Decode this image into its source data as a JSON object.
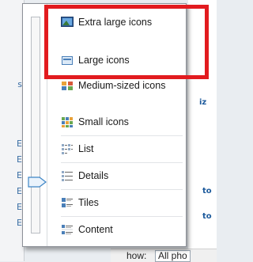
{
  "menu": {
    "items": [
      {
        "label": "Extra large icons",
        "icon": "extra-large-icons-icon"
      },
      {
        "label": "Large icons",
        "icon": "large-icons-icon"
      },
      {
        "label": "Medium-sized icons",
        "icon": "medium-icons-icon"
      },
      {
        "label": "Small icons",
        "icon": "small-icons-icon"
      },
      {
        "label": "List",
        "icon": "list-icon"
      },
      {
        "label": "Details",
        "icon": "details-icon"
      },
      {
        "label": "Tiles",
        "icon": "tiles-icon"
      },
      {
        "label": "Content",
        "icon": "content-icon"
      }
    ],
    "highlight_color": "#e21b1f"
  },
  "background": {
    "left_fragments": [
      "s",
      "E",
      "E",
      "E",
      "E",
      "E",
      "E"
    ],
    "right_fragments": [
      "iz",
      "to",
      "to"
    ],
    "show_label": "how:",
    "show_value": "All pho"
  }
}
